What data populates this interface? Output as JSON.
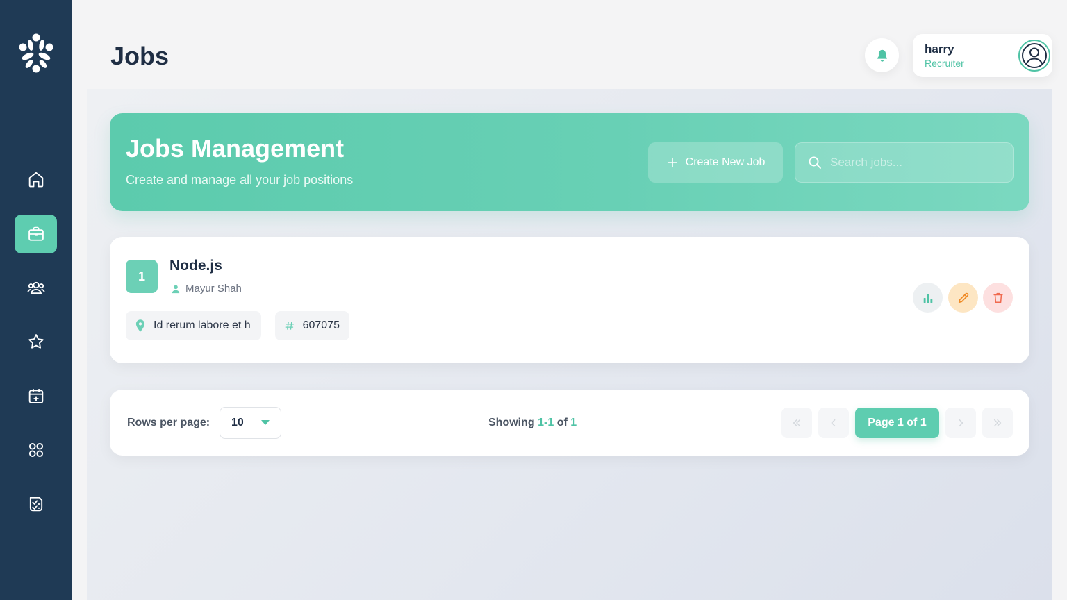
{
  "sidebar": {
    "logo": "flower-logo",
    "items": [
      {
        "icon": "home-icon",
        "active": false
      },
      {
        "icon": "briefcase-icon",
        "active": true
      },
      {
        "icon": "users-icon",
        "active": false
      },
      {
        "icon": "star-icon",
        "active": false
      },
      {
        "icon": "calendar-plus-icon",
        "active": false
      },
      {
        "icon": "grid-icon",
        "active": false
      },
      {
        "icon": "checklist-icon",
        "active": false
      }
    ]
  },
  "header": {
    "title": "Jobs",
    "notification_icon": "bell-icon",
    "user": {
      "name": "harry",
      "role": "Recruiter",
      "avatar_icon": "user-circle-icon"
    }
  },
  "hero": {
    "title": "Jobs Management",
    "subtitle": "Create and manage all your job positions",
    "create_label": "Create New Job",
    "search_placeholder": "Search jobs..."
  },
  "jobs": [
    {
      "index": "1",
      "title": "Node.js",
      "owner": "Mayur Shah",
      "location": "Id rerum labore et h",
      "code": "607075",
      "actions": [
        "chart-icon",
        "pencil-icon",
        "trash-icon"
      ]
    }
  ],
  "pagination": {
    "rows_label": "Rows per page:",
    "rows_value": "10",
    "showing_prefix": "Showing",
    "showing_range": "1-1",
    "showing_of": "of",
    "showing_total": "1",
    "current_page_label": "Page 1 of 1"
  },
  "colors": {
    "sidebar": "#1f3a55",
    "accent": "#5ecdb0",
    "text_dark": "#1f2e44",
    "edit_bg": "#fde6c3",
    "delete_bg": "#fde0e0"
  }
}
